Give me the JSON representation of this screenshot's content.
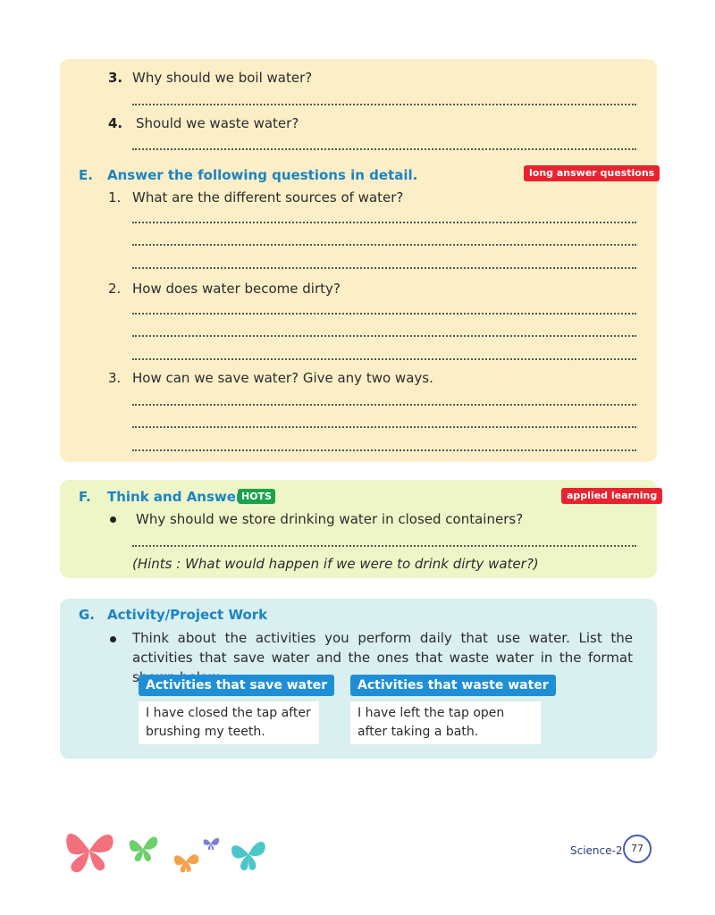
{
  "section_d": {
    "q3_num": "3.",
    "q3_text": "Why should we boil water?",
    "q4_num": "4.",
    "q4_text": "Should we waste water?"
  },
  "section_e": {
    "letter": "E.",
    "title": "Answer the following questions in detail.",
    "tag": "long answer questions",
    "q1_num": "1.",
    "q1_text": "What are the different sources of water?",
    "q2_num": "2.",
    "q2_text": "How does water become dirty?",
    "q3_num": "3.",
    "q3_text": "How can we save water? Give any two ways."
  },
  "section_f": {
    "letter": "F.",
    "title": "Think and Answer!",
    "hots": "HOTS",
    "tag": "applied learning",
    "question": "Why should we store drinking water in closed containers?",
    "hint": "(Hints : What would happen if we were to drink dirty water?)"
  },
  "section_g": {
    "letter": "G.",
    "title": "Activity/Project Work",
    "paragraph": "Think about the activities you perform daily that use water. List the activities that save water and the ones that waste water in the format shown below.",
    "save_header": "Activities that save water",
    "save_text": "I have closed the tap after brushing my teeth.",
    "waste_header": "Activities that waste water",
    "waste_text": "I have left the tap open after taking a bath."
  },
  "footer": {
    "book": "Science-2",
    "page": "77"
  },
  "colors": {
    "heading": "#1b84c4",
    "tag_red": "#e8232f",
    "hots_green": "#1aa34a",
    "panel_yellow": "#fcefc8",
    "panel_green": "#eef6c8",
    "panel_teal": "#d9eff0",
    "column_header": "#1e8fd6"
  }
}
